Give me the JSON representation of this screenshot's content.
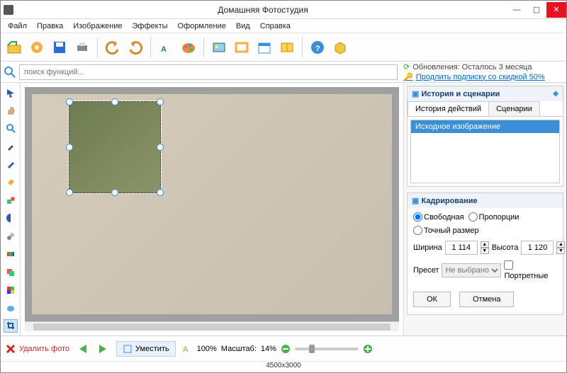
{
  "window": {
    "title": "Домашняя Фотостудия"
  },
  "menu": {
    "items": [
      "Файл",
      "Правка",
      "Изображение",
      "Эффекты",
      "Оформление",
      "Вид",
      "Справка"
    ]
  },
  "toolbar_icons": [
    "open",
    "settings-gear",
    "save",
    "print",
    "undo",
    "redo",
    "text",
    "palette",
    "image",
    "frame",
    "calendar",
    "share",
    "help",
    "package"
  ],
  "search": {
    "placeholder": "поиск функций..."
  },
  "updates": {
    "line1": "Обновления: Осталось  3 месяца",
    "line2": "Продлить подписку со скидкой 50%"
  },
  "left_tools": [
    "pointer",
    "hand",
    "magnifier",
    "eyedropper",
    "pen",
    "bucket",
    "shapes",
    "contrast",
    "clone",
    "rainbow",
    "layers",
    "color",
    "eraser",
    "crop"
  ],
  "history": {
    "panel_title": "История и сценарии",
    "tab_history": "История действий",
    "tab_scenarios": "Сценарии",
    "items": [
      "Исходное изображение"
    ]
  },
  "crop": {
    "panel_title": "Кадрирование",
    "mode_free": "Свободная",
    "mode_prop": "Пропорции",
    "mode_exact": "Точный размер",
    "width_label": "Ширина",
    "width_value": "1 114",
    "height_label": "Высота",
    "height_value": "1 120",
    "preset_label": "Пресет",
    "preset_value": "Не выбрано",
    "portrait_label": "Портретные",
    "ok": "ОК",
    "cancel": "Отмена"
  },
  "status": {
    "delete": "Удалить фото",
    "fit": "Уместить",
    "zoom_100": "100%",
    "scale_label": "Масштаб:",
    "scale_value": "14%",
    "dimensions": "4500x3000"
  }
}
